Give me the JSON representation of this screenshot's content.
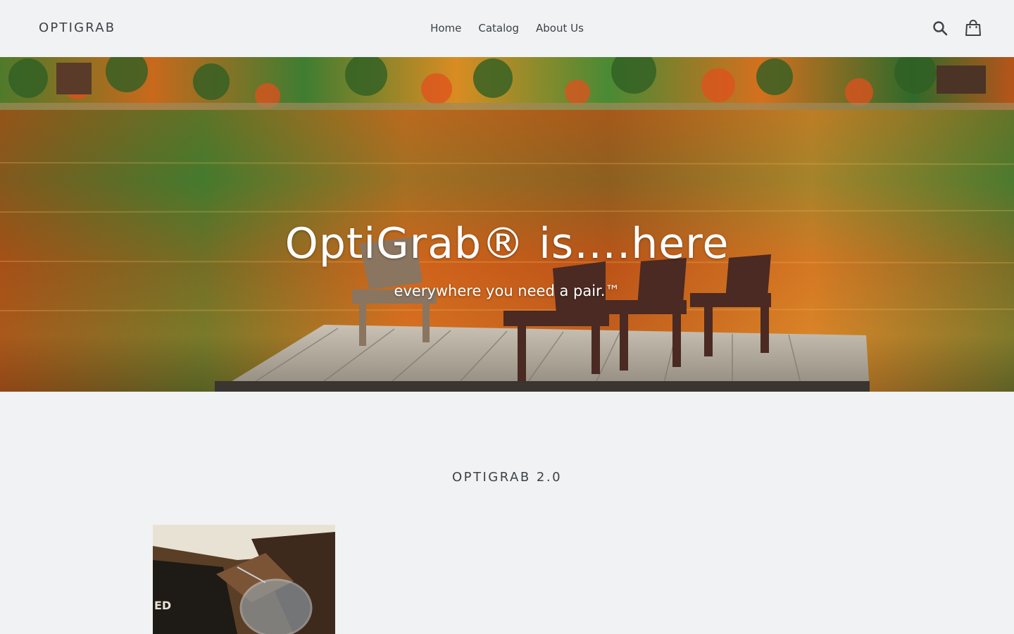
{
  "header": {
    "logo": "OPTIGRAB",
    "nav": [
      {
        "label": "Home"
      },
      {
        "label": "Catalog"
      },
      {
        "label": "About Us"
      }
    ],
    "icons": {
      "search": "search-icon",
      "cart": "cart-icon"
    }
  },
  "hero": {
    "title": "OptiGrab® is….here",
    "subtitle": "everywhere you need a pair.™"
  },
  "collection": {
    "title": "OPTIGRAB 2.0",
    "product_image_text": "ED"
  },
  "colors": {
    "background": "#f0f2f4",
    "text": "#3d4246",
    "hero_text": "#ffffff"
  }
}
